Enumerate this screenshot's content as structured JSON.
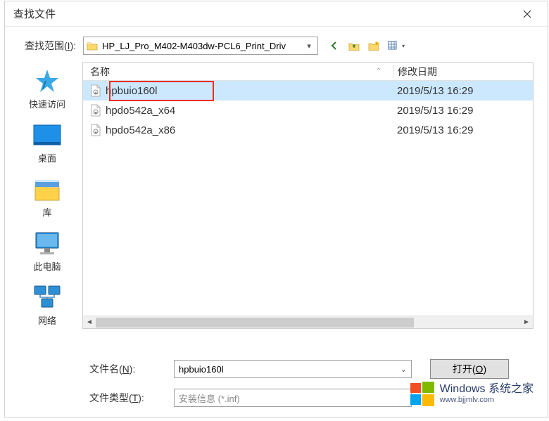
{
  "window": {
    "title": "查找文件"
  },
  "lookIn": {
    "label_pre": "查找范围(",
    "accel": "I",
    "label_post": "):",
    "folder_name": "HP_LJ_Pro_M402-M403dw-PCL6_Print_Driv"
  },
  "places": [
    {
      "id": "quick-access",
      "label": "快速访问"
    },
    {
      "id": "desktop",
      "label": "桌面"
    },
    {
      "id": "libraries",
      "label": "库"
    },
    {
      "id": "this-pc",
      "label": "此电脑"
    },
    {
      "id": "network",
      "label": "网络"
    }
  ],
  "columns": {
    "name": "名称",
    "date": "修改日期"
  },
  "files": [
    {
      "name": "hpbuio160l",
      "date": "2019/5/13 16:29",
      "selected": true
    },
    {
      "name": "hpdo542a_x64",
      "date": "2019/5/13 16:29",
      "selected": false
    },
    {
      "name": "hpdo542a_x86",
      "date": "2019/5/13 16:29",
      "selected": false
    }
  ],
  "form": {
    "filename_label_pre": "文件名(",
    "filename_accel": "N",
    "filename_label_post": "):",
    "filename_value": "hpbuio160l",
    "filetype_label_pre": "文件类型(",
    "filetype_accel": "T",
    "filetype_label_post": "):",
    "filetype_value": "安装信息 (*.inf)",
    "open_label": "打开(",
    "open_accel": "O",
    "open_post": ")"
  },
  "watermark": {
    "main": "Windows 系统之家",
    "sub": "www.bjjmlv.com"
  }
}
